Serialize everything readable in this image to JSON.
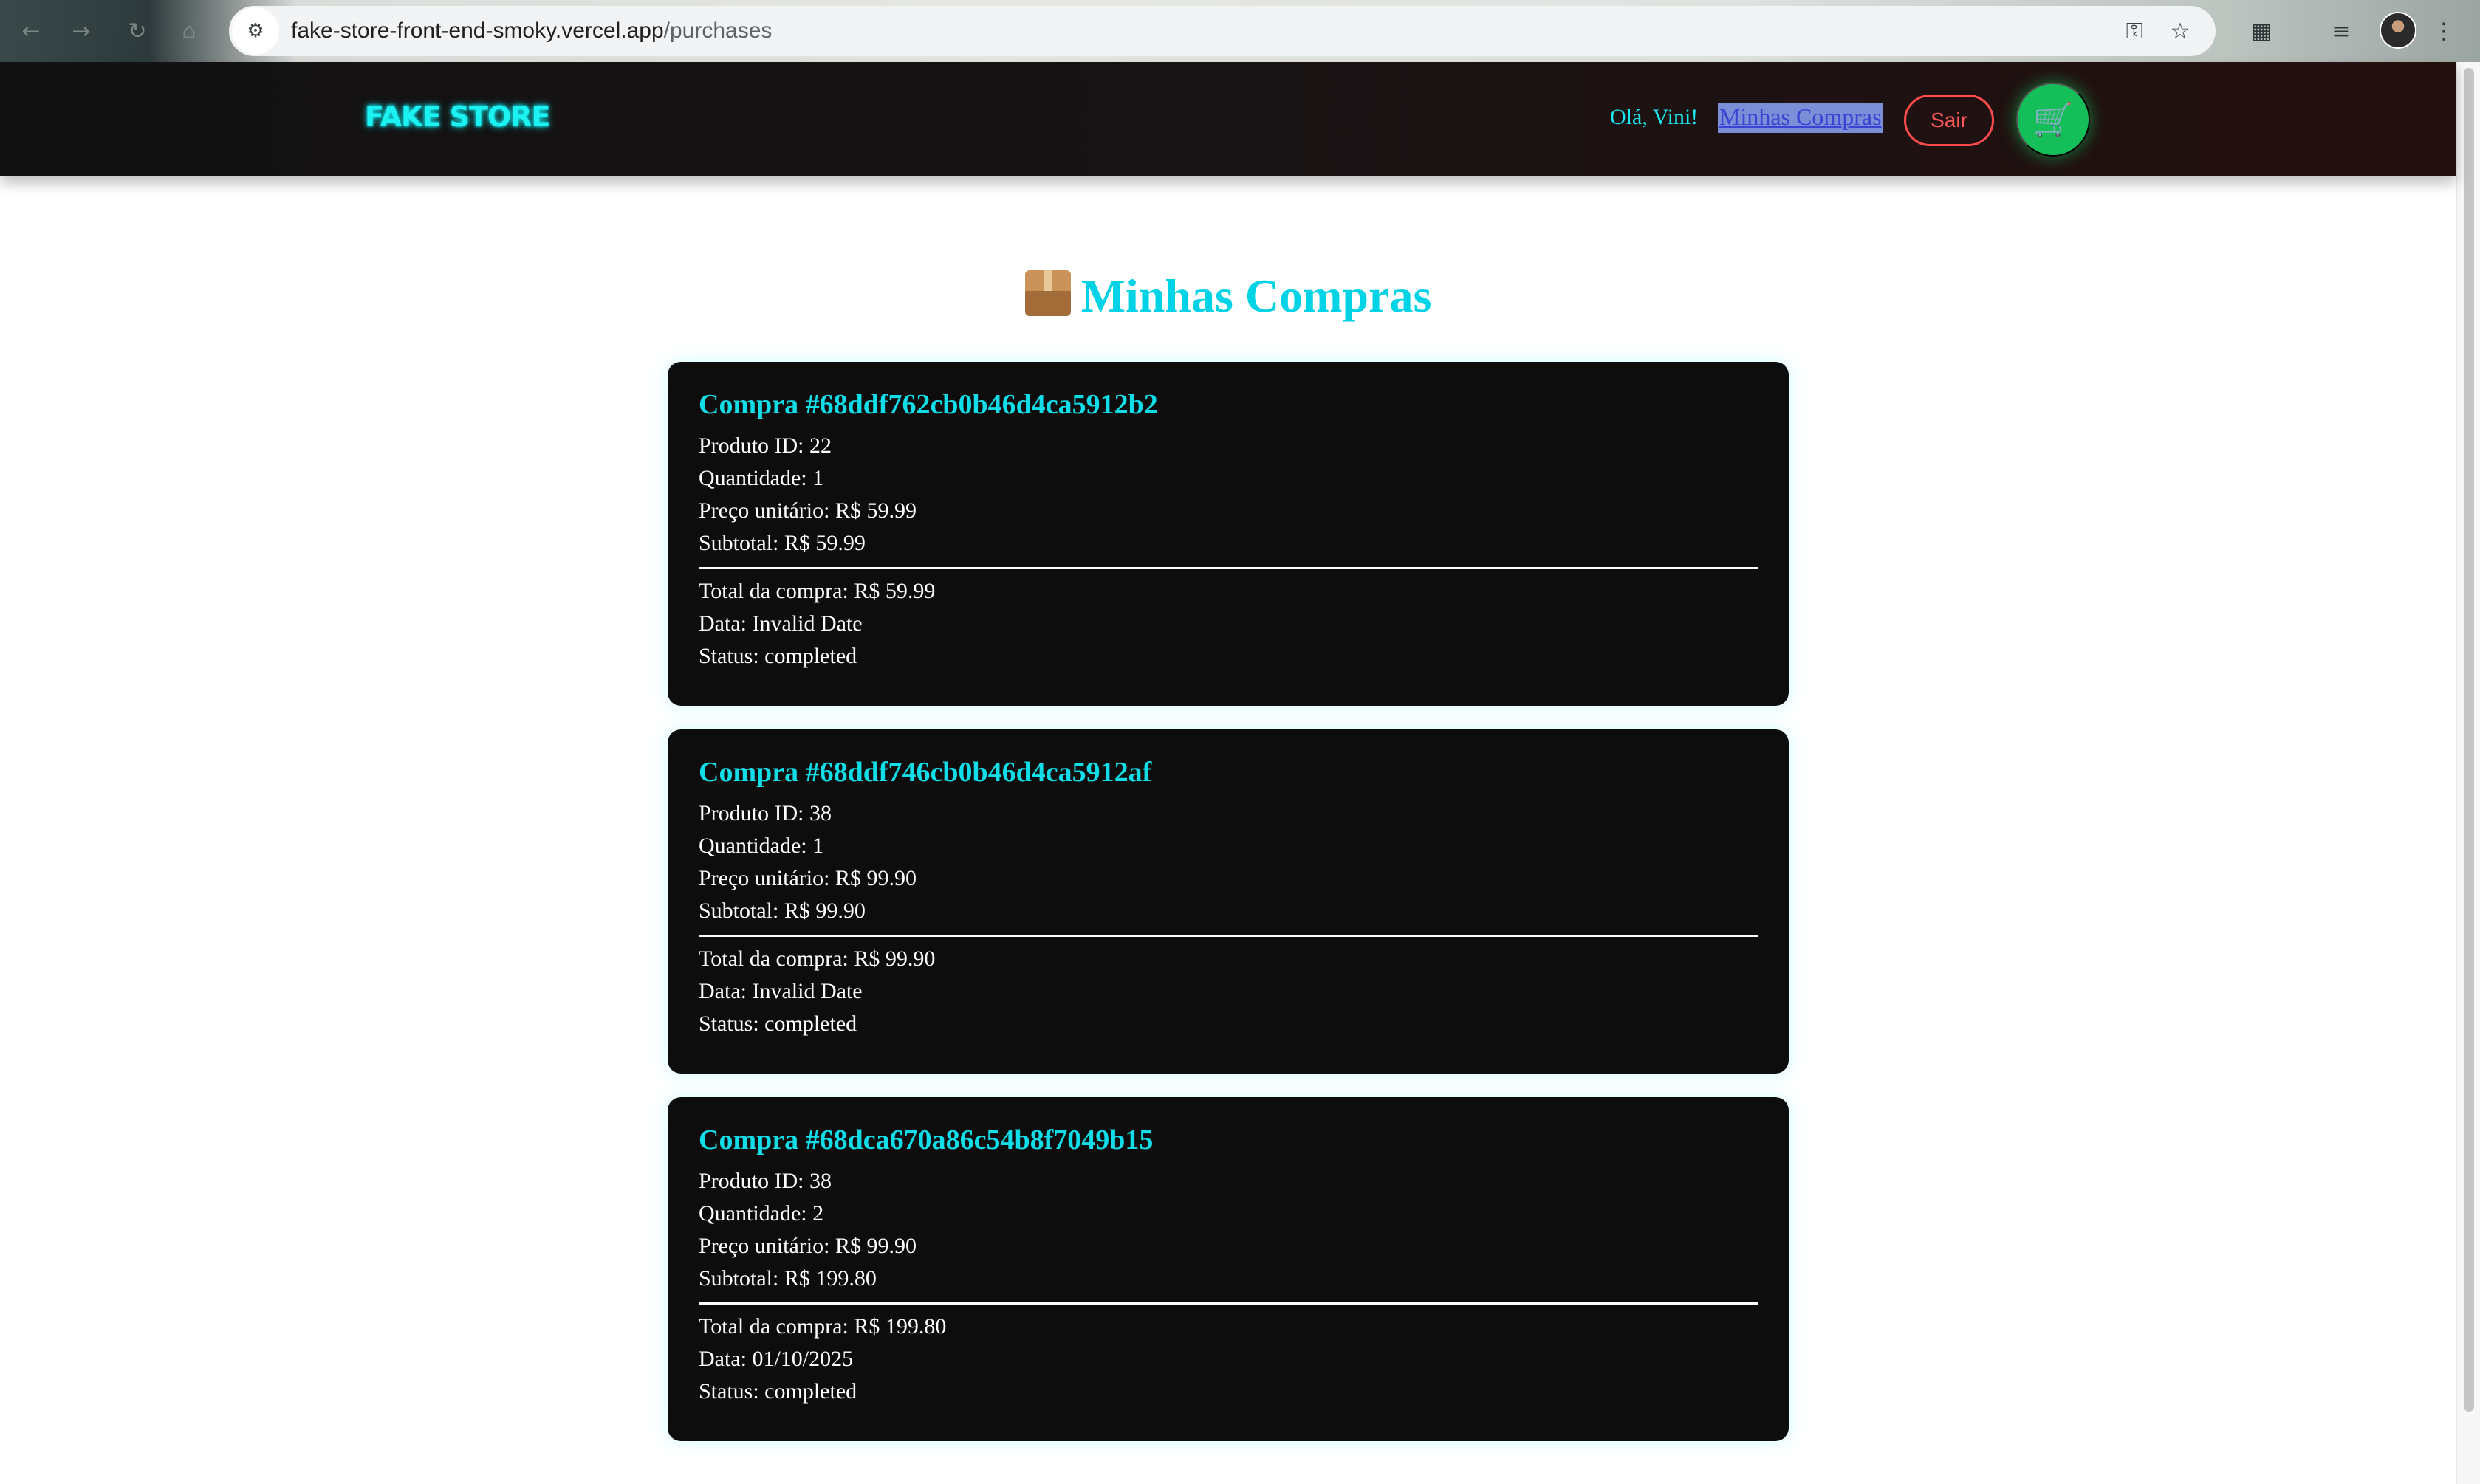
{
  "browser": {
    "url_host": "fake-store-front-end-smoky.vercel.app",
    "url_path": "/purchases",
    "icons": [
      "back-icon",
      "forward-icon",
      "reload-icon",
      "home-icon",
      "site-info-icon",
      "password-key-icon",
      "bookmark-star-icon",
      "extensions-icon",
      "media-queue-icon",
      "profile-avatar",
      "menu-icon"
    ]
  },
  "header": {
    "logo": "FAKE STORE",
    "greeting": "Olá, Vini!",
    "purchases_link": "Minhas Compras",
    "logout_label": "Sair",
    "cart_icon": "🛒"
  },
  "main": {
    "title": "Minhas Compras",
    "title_icon": "package-icon"
  },
  "purchases": [
    {
      "title": "Compra #68ddf762cb0b46d4ca5912b2",
      "product_id": "Produto ID: 22",
      "quantity": "Quantidade: 1",
      "unit_price": "Preço unitário: R$ 59.99",
      "subtotal": "Subtotal: R$ 59.99",
      "total": "Total da compra: R$ 59.99",
      "date": "Data: Invalid Date",
      "status": "Status: completed"
    },
    {
      "title": "Compra #68ddf746cb0b46d4ca5912af",
      "product_id": "Produto ID: 38",
      "quantity": "Quantidade: 1",
      "unit_price": "Preço unitário: R$ 99.90",
      "subtotal": "Subtotal: R$ 99.90",
      "total": "Total da compra: R$ 99.90",
      "date": "Data: Invalid Date",
      "status": "Status: completed"
    },
    {
      "title": "Compra #68dca670a86c54b8f7049b15",
      "product_id": "Produto ID: 38",
      "quantity": "Quantidade: 2",
      "unit_price": "Preço unitário: R$ 99.90",
      "subtotal": "Subtotal: R$ 199.80",
      "total": "Total da compra: R$ 199.80",
      "date": "Data: 01/10/2025",
      "status": "Status: completed"
    }
  ],
  "colors": {
    "accent_cyan": "#00d3e6",
    "logout_red": "#ff4b4b",
    "cart_green": "#14bf5a",
    "card_bg": "#0d0d0d"
  }
}
